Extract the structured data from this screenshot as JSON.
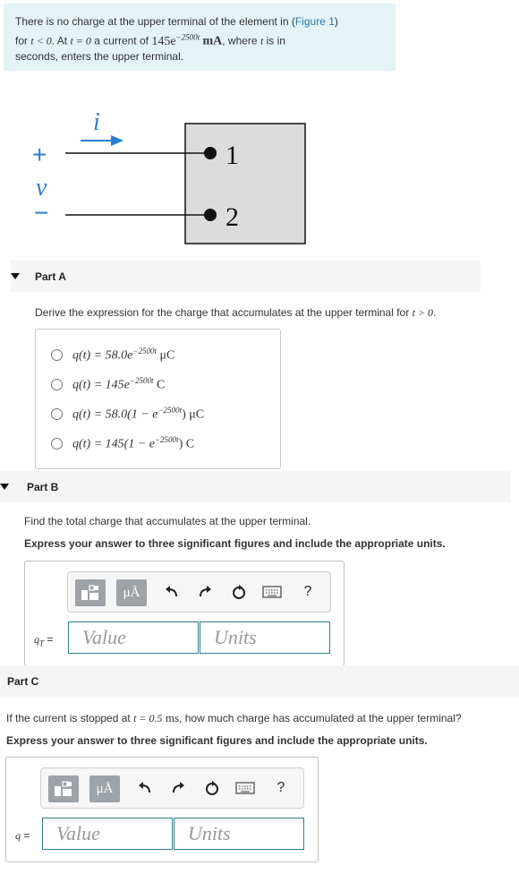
{
  "problem": {
    "text_1": "There is no charge at the upper terminal of the element in (",
    "figure_link": "Figure 1",
    "text_2": ")",
    "line2_for": "for",
    "cond1": "t < 0",
    "at": ". At",
    "cond2": "t = 0",
    "current_pre": "a current of",
    "current_coef": "145e",
    "current_exp": "−2500t",
    "current_unit": "mA",
    "where": ", where",
    "t_var": "t",
    "is_in": "is in",
    "line3": "seconds, enters the upper terminal."
  },
  "figure": {
    "current_label": "i",
    "plus": "+",
    "voltage_label": "v",
    "minus": "−",
    "terminal_1": "1",
    "terminal_2": "2"
  },
  "partA": {
    "title": "Part A",
    "prompt": "Derive the expression for the charge that accumulates at the upper terminal for",
    "cond": "t > 0",
    "choices": [
      {
        "left": "q(t) = 58.0e",
        "exp": "−2500t",
        "right": " μC"
      },
      {
        "left": "q(t) = 145e",
        "exp": "−2500t",
        "right": " C"
      },
      {
        "left": "q(t) = 58.0(1 − e",
        "exp": "−2500t",
        "right": ") μC"
      },
      {
        "left": "q(t) = 145(1 − e",
        "exp": "−2500t",
        "right": ") C"
      }
    ]
  },
  "partB": {
    "title": "Part B",
    "prompt": "Find the total charge that accumulates at the upper terminal.",
    "instruction": "Express your answer to three significant figures and include the appropriate units.",
    "var_name": "q",
    "var_sub": "T",
    "equals": "=",
    "value_placeholder": "Value",
    "units_placeholder": "Units"
  },
  "partC": {
    "title": "Part C",
    "prompt_1": "If the current is stopped at",
    "cond": "t = 0.5",
    "unit": "ms",
    "prompt_2": ", how much charge has accumulated at the upper terminal?",
    "instruction": "Express your answer to three significant figures and include the appropriate units.",
    "var_name": "q",
    "equals": "=",
    "value_placeholder": "Value",
    "units_placeholder": "Units"
  },
  "toolbar": {
    "units_button": "μÅ",
    "help": "?"
  },
  "colors": {
    "problem_bg": "#e3f3f6",
    "link": "#2a7ab0",
    "figure_blue": "#2b7fd1",
    "field_border": "#2c7f90"
  }
}
